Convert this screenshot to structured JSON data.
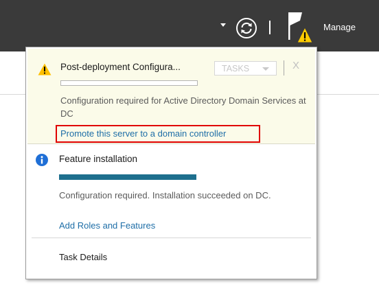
{
  "header": {
    "manage_label": "Manage",
    "icons": [
      "dropdown-arrow-icon",
      "refresh-icon",
      "flag-icon",
      "warning-icon"
    ]
  },
  "notifications": [
    {
      "type": "warning",
      "title": "Post-deployment Configura...",
      "tasks_label": "TASKS",
      "close_label": "X",
      "progress": 0,
      "description": "Configuration required for Active Directory Domain Services at DC",
      "link": "Promote this server to a domain controller"
    },
    {
      "type": "info",
      "title": "Feature installation",
      "progress": 1,
      "description": "Configuration required. Installation succeeded on DC.",
      "link": "Add Roles and Features"
    }
  ],
  "footer": {
    "task_details": "Task Details"
  },
  "colors": {
    "topbar": "#3a3a3a",
    "warning_bg": "#fbfbe9",
    "link": "#1e6ea7",
    "progress": "#1e6f8e",
    "highlight": "#e00000"
  }
}
